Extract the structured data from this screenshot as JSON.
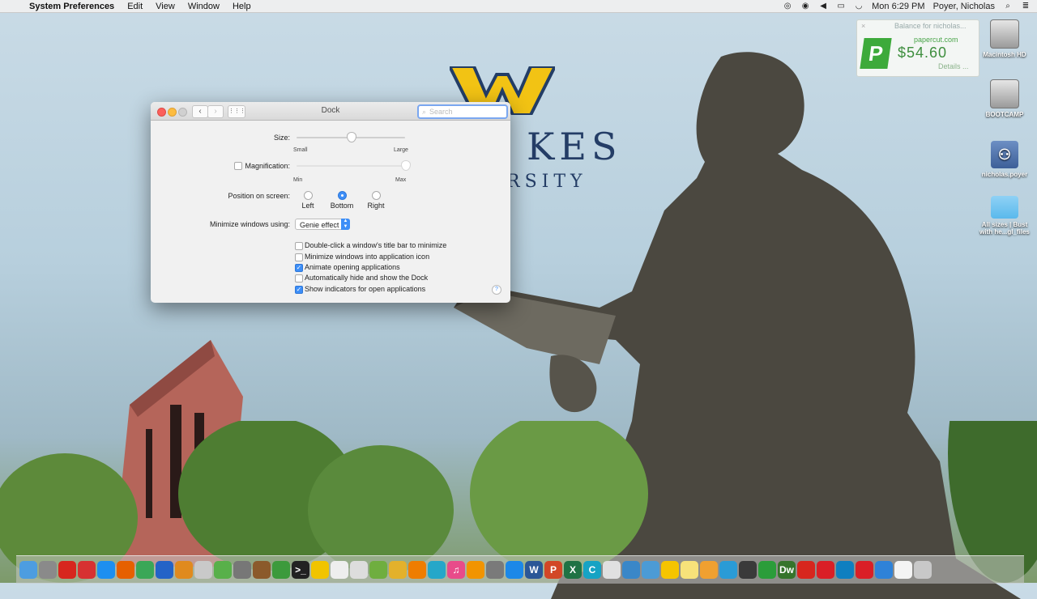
{
  "menubar": {
    "apple": "",
    "app_name": "System Preferences",
    "items": [
      "Edit",
      "View",
      "Window",
      "Help"
    ],
    "clock": "Mon 6:29 PM",
    "user": "Poyer, Nicholas"
  },
  "notification": {
    "title": "Balance for nicholas...",
    "close": "×",
    "logo": "P",
    "site": "papercut.com",
    "amount": "$54.60",
    "details": "Details ..."
  },
  "wallpaper": {
    "text_line1": "KES",
    "text_line2": "RSITY"
  },
  "desktop_icons": [
    {
      "label": "Macintosh HD"
    },
    {
      "label": "BOOTCAMP"
    },
    {
      "label": "nicholas.poyer"
    },
    {
      "label": "All sizes | Bust with he...gl_files"
    }
  ],
  "window": {
    "title": "Dock",
    "search_placeholder": "Search",
    "back": "‹",
    "forward": "›",
    "grid": "⋮⋮⋮",
    "size": {
      "label": "Size:",
      "min_label": "Small",
      "max_label": "Large",
      "value": 0.5
    },
    "magnification": {
      "label": "Magnification:",
      "checked": false,
      "min_label": "Min",
      "max_label": "Max",
      "value": 1.0
    },
    "position": {
      "label": "Position on screen:",
      "options": [
        "Left",
        "Bottom",
        "Right"
      ],
      "selected": "Bottom"
    },
    "minimize": {
      "label": "Minimize windows using:",
      "value": "Genie effect"
    },
    "checkboxes": [
      {
        "label": "Double-click a window's title bar to minimize",
        "checked": false
      },
      {
        "label": "Minimize windows into application icon",
        "checked": false
      },
      {
        "label": "Animate opening applications",
        "checked": true
      },
      {
        "label": "Automatically hide and show the Dock",
        "checked": false
      },
      {
        "label": "Show indicators for open applications",
        "checked": true
      }
    ],
    "help": "?"
  },
  "dock": {
    "items": [
      {
        "name": "finder",
        "color": "#4d9de0"
      },
      {
        "name": "launchpad",
        "color": "#8a8a8a"
      },
      {
        "name": "acrobat",
        "color": "#d7261e"
      },
      {
        "name": "stats",
        "color": "#d73131"
      },
      {
        "name": "safari",
        "color": "#1d8ff0"
      },
      {
        "name": "firefox",
        "color": "#e66000"
      },
      {
        "name": "chrome",
        "color": "#3aa757"
      },
      {
        "name": "app8",
        "color": "#2463c7"
      },
      {
        "name": "app9",
        "color": "#e08a1e"
      },
      {
        "name": "app10",
        "color": "#c9c9c9"
      },
      {
        "name": "app11",
        "color": "#58b04a"
      },
      {
        "name": "app12",
        "color": "#777"
      },
      {
        "name": "app13",
        "color": "#8b5a2b"
      },
      {
        "name": "app14",
        "color": "#3c9a3c"
      },
      {
        "name": "terminal",
        "color": "#222"
      },
      {
        "name": "app16",
        "color": "#f1c400"
      },
      {
        "name": "app17",
        "color": "#eee"
      },
      {
        "name": "app18",
        "color": "#ddd"
      },
      {
        "name": "app19",
        "color": "#6fae3f"
      },
      {
        "name": "app20",
        "color": "#e3b12b"
      },
      {
        "name": "vlc",
        "color": "#ef7d00"
      },
      {
        "name": "app22",
        "color": "#25a7c9"
      },
      {
        "name": "itunes",
        "color": "#e84b8a"
      },
      {
        "name": "ibooks",
        "color": "#f29400"
      },
      {
        "name": "sysprefs",
        "color": "#7a7a7a"
      },
      {
        "name": "appstore",
        "color": "#1c88e8"
      },
      {
        "name": "word",
        "color": "#2b5797"
      },
      {
        "name": "powerpoint",
        "color": "#d24726"
      },
      {
        "name": "excel",
        "color": "#1f7244"
      },
      {
        "name": "app30",
        "color": "#16a3c4"
      },
      {
        "name": "app31",
        "color": "#e0e0e0"
      },
      {
        "name": "app32",
        "color": "#3a87c8"
      },
      {
        "name": "app33",
        "color": "#4c9bd5"
      },
      {
        "name": "app34",
        "color": "#f5c400"
      },
      {
        "name": "notes",
        "color": "#f7e27a"
      },
      {
        "name": "app36",
        "color": "#f0a030"
      },
      {
        "name": "app37",
        "color": "#2a9bd6"
      },
      {
        "name": "app38",
        "color": "#3a3a3a"
      },
      {
        "name": "app39",
        "color": "#2b9d3a"
      },
      {
        "name": "dreamweaver",
        "color": "#35742b"
      },
      {
        "name": "acrobat2",
        "color": "#d7261e"
      },
      {
        "name": "creative-cloud",
        "color": "#da1f26"
      },
      {
        "name": "app43",
        "color": "#0f7fc0"
      },
      {
        "name": "creative-cloud2",
        "color": "#da1f26"
      },
      {
        "name": "app45",
        "color": "#2f82d8"
      },
      {
        "name": "document",
        "color": "#f4f4f4"
      },
      {
        "name": "trash",
        "color": "#c8c8c8"
      }
    ],
    "glyphs": [
      "",
      "",
      "",
      "",
      "",
      "",
      "",
      "",
      "",
      "",
      "",
      "",
      "",
      "",
      ">_",
      "",
      "",
      "",
      "",
      "",
      "",
      "",
      "♫",
      "",
      "",
      "",
      "W",
      "P",
      "X",
      "C",
      "",
      "",
      "",
      "",
      "",
      "",
      "",
      "",
      "",
      "Dw",
      "",
      "",
      "",
      "",
      "",
      "",
      ""
    ]
  }
}
